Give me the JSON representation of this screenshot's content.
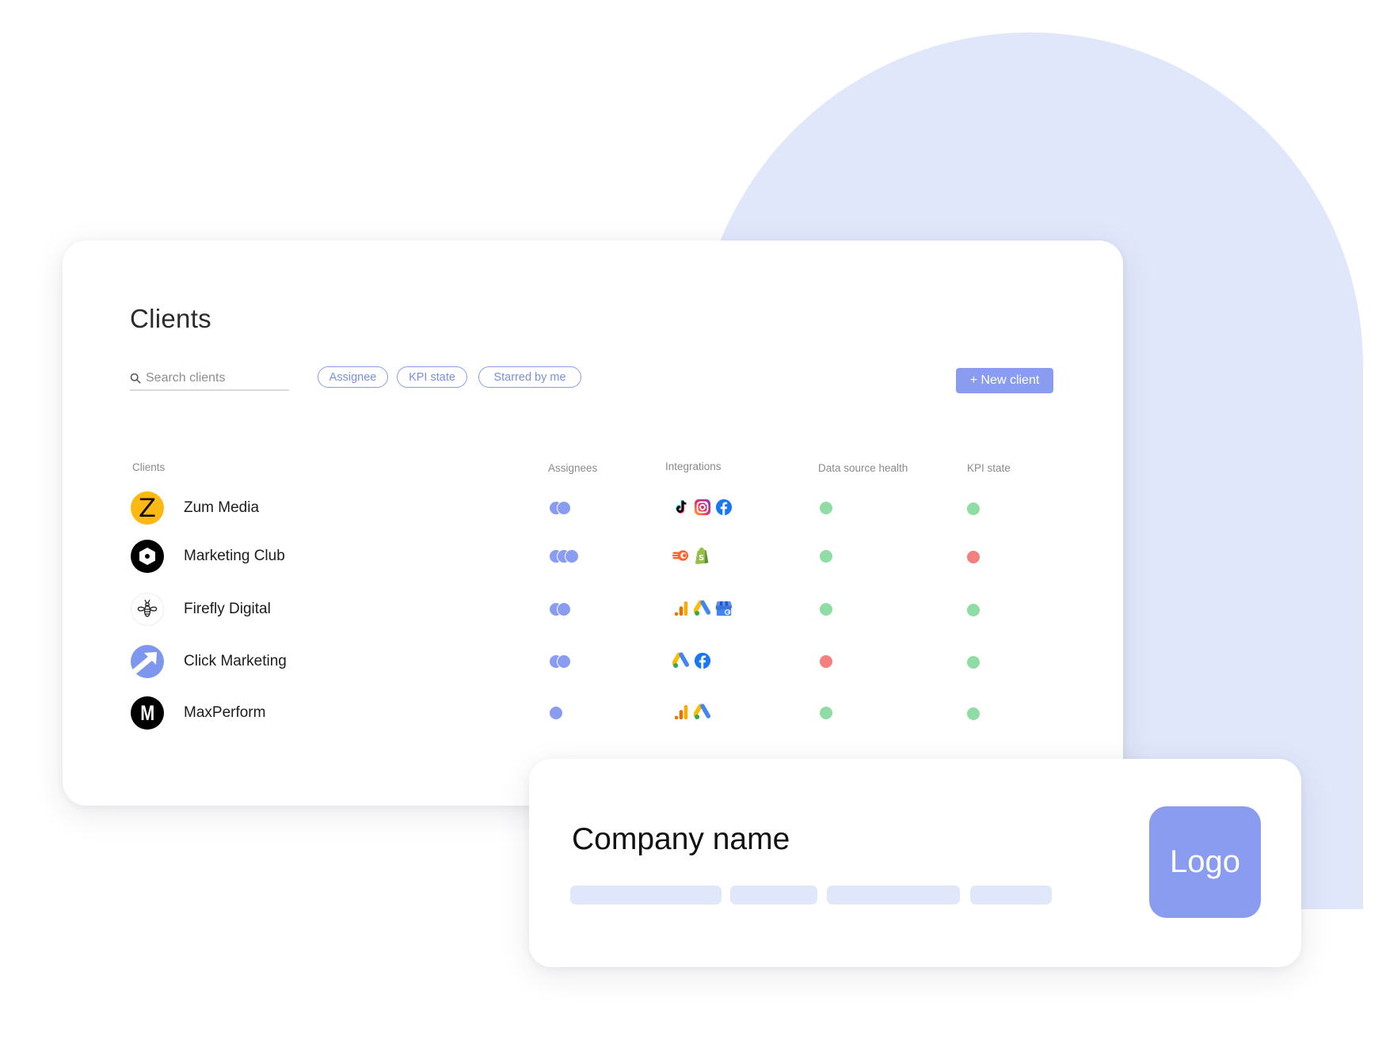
{
  "colors": {
    "accent": "#8a9cf0",
    "background_shape": "#e1e7fb",
    "status_ok": "#8fdca5",
    "status_error": "#f47f7f"
  },
  "clients_panel": {
    "title": "Clients",
    "search": {
      "placeholder": "Search clients",
      "value": ""
    },
    "filters": [
      {
        "label": "Assignee"
      },
      {
        "label": "KPI state"
      },
      {
        "label": "Starred by me"
      }
    ],
    "new_client_label": "+ New client",
    "columns": [
      "Clients",
      "Assignees",
      "Integrations",
      "Data source health",
      "KPI state"
    ],
    "rows": [
      {
        "name": "Zum Media",
        "avatar": "z-letter-logo",
        "assignee_count": 2,
        "integrations": [
          "tiktok-icon",
          "instagram-icon",
          "facebook-icon"
        ],
        "data_source_health": "ok",
        "kpi_state": "ok"
      },
      {
        "name": "Marketing Club",
        "avatar": "hexagon-logo",
        "assignee_count": 3,
        "integrations": [
          "semrush-icon",
          "shopify-icon"
        ],
        "data_source_health": "ok",
        "kpi_state": "error"
      },
      {
        "name": "Firefly Digital",
        "avatar": "bee-logo",
        "assignee_count": 2,
        "integrations": [
          "google-analytics-icon",
          "google-ads-icon",
          "google-business-icon"
        ],
        "data_source_health": "ok",
        "kpi_state": "ok"
      },
      {
        "name": "Click Marketing",
        "avatar": "arrow-logo",
        "assignee_count": 2,
        "integrations": [
          "google-ads-icon",
          "facebook-icon"
        ],
        "data_source_health": "error",
        "kpi_state": "ok"
      },
      {
        "name": "MaxPerform",
        "avatar": "m-letter-logo",
        "assignee_count": 1,
        "integrations": [
          "google-analytics-icon",
          "google-ads-icon"
        ],
        "data_source_health": "ok",
        "kpi_state": "ok"
      }
    ]
  },
  "company_card": {
    "title": "Company name",
    "logo_label": "Logo",
    "skeleton_tag_count": 4
  }
}
